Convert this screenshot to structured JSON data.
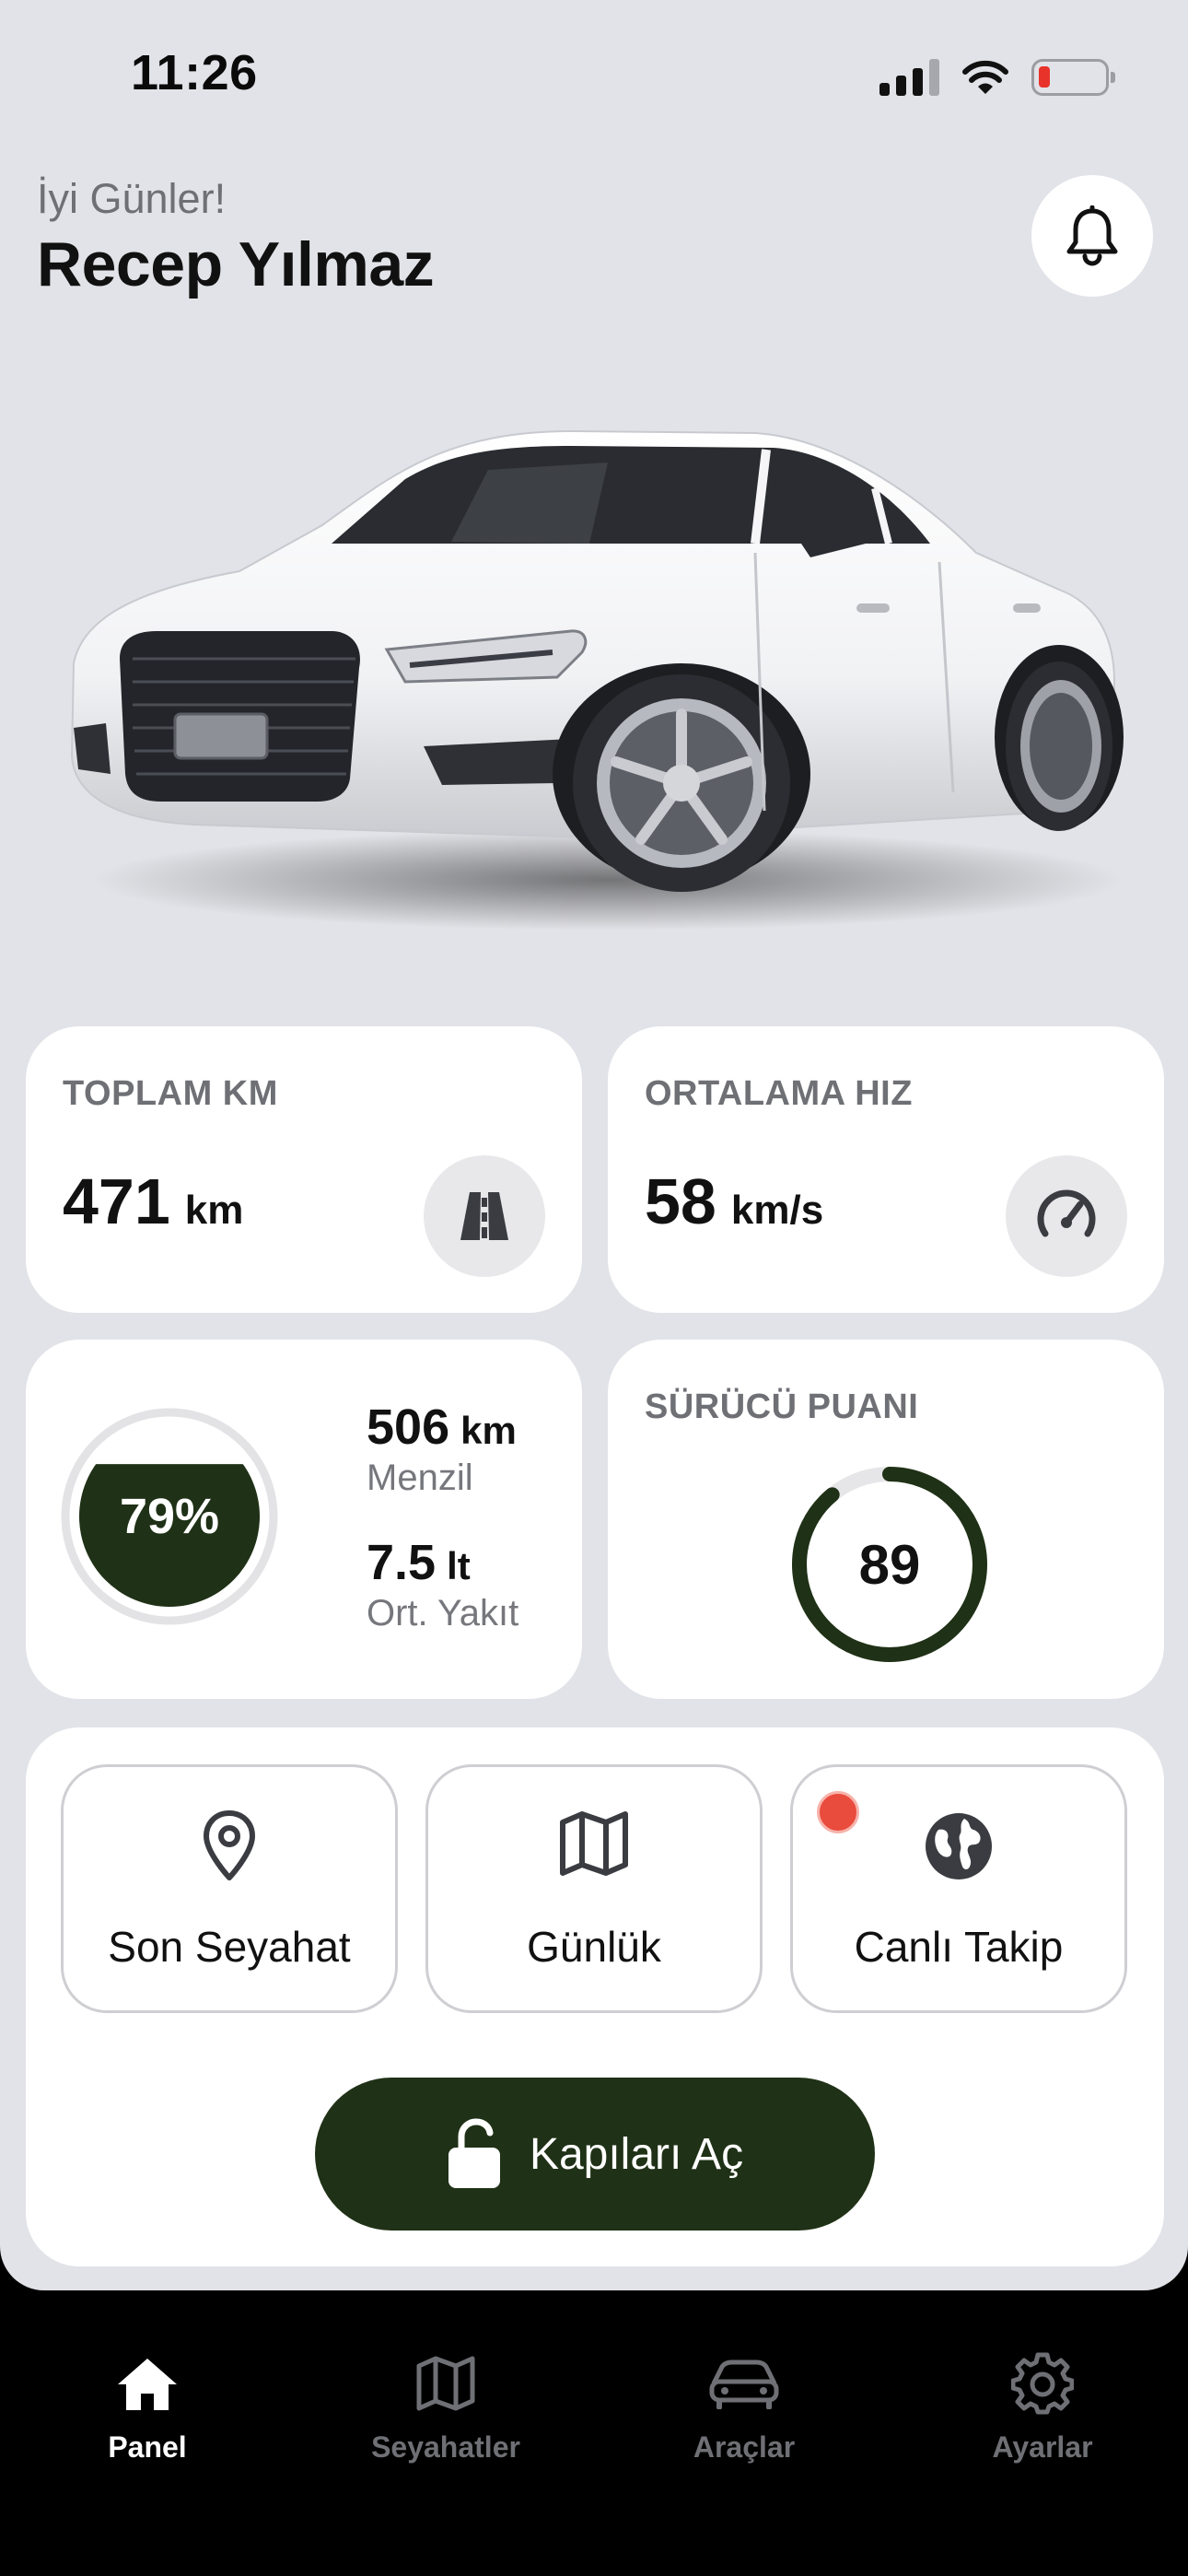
{
  "status_bar": {
    "time": "11:26"
  },
  "header": {
    "greeting": "İyi Günler!",
    "user_name": "Recep Yılmaz"
  },
  "stats": {
    "total_km": {
      "label": "TOPLAM KM",
      "value": "471",
      "unit": "km",
      "icon": "road-icon"
    },
    "avg_speed": {
      "label": "ORTALAMA HIZ",
      "value": "58",
      "unit": "km/s",
      "icon": "speedometer-icon"
    }
  },
  "fuel": {
    "percent_label": "79%",
    "level": 0.79,
    "range_value": "506",
    "range_unit": "km",
    "range_label": "Menzil",
    "consumption_value": "7.5",
    "consumption_unit": "lt",
    "consumption_label": "Ort. Yakıt"
  },
  "driver_score": {
    "label": "SÜRÜCÜ PUANI",
    "value": "89",
    "progress": 0.89
  },
  "actions": [
    {
      "label": "Son Seyahat",
      "icon": "location-pin-icon"
    },
    {
      "label": "Günlük",
      "icon": "map-icon"
    },
    {
      "label": "Canlı Takip",
      "icon": "globe-icon"
    }
  ],
  "unlock_button": {
    "label": "Kapıları Aç",
    "icon": "unlock-icon"
  },
  "tabs": [
    {
      "label": "Panel",
      "icon": "home-icon",
      "active": true
    },
    {
      "label": "Seyahatler",
      "icon": "map-icon",
      "active": false
    },
    {
      "label": "Araçlar",
      "icon": "car-icon",
      "active": false
    },
    {
      "label": "Ayarlar",
      "icon": "gear-icon",
      "active": false
    }
  ],
  "colors": {
    "accent": "#1f3116",
    "background": "#e2e3e8",
    "card": "#ffffff",
    "live": "#e94b3c"
  }
}
